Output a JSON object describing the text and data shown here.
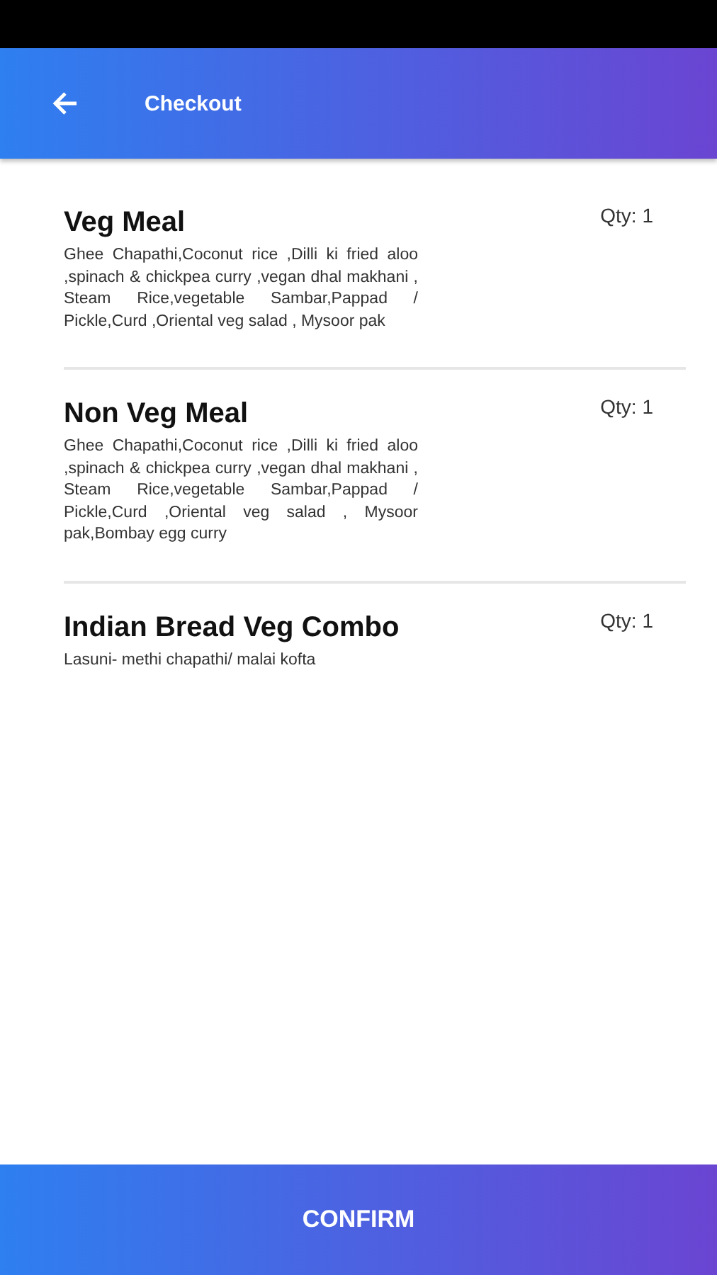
{
  "app_bar": {
    "title": "Checkout"
  },
  "items": [
    {
      "name": "Veg Meal",
      "description": "Ghee Chapathi,Coconut rice ,Dilli ki fried aloo ,spinach & chickpea curry ,vegan dhal makhani , Steam Rice,vegetable Sambar,Pappad / Pickle,Curd ,Oriental veg salad , Mysoor pak",
      "quantity": "Qty: 1"
    },
    {
      "name": "Non Veg Meal",
      "description": "Ghee Chapathi,Coconut rice ,Dilli ki fried aloo ,spinach & chickpea curry ,vegan dhal makhani , Steam Rice,vegetable Sambar,Pappad / Pickle,Curd ,Oriental veg salad , Mysoor pak,Bombay egg curry",
      "quantity": "Qty: 1"
    },
    {
      "name": "Indian Bread Veg Combo",
      "description": "Lasuni- methi chapathi/ malai kofta",
      "quantity": "Qty: 1"
    }
  ],
  "confirm_button": {
    "label": "CONFIRM"
  }
}
